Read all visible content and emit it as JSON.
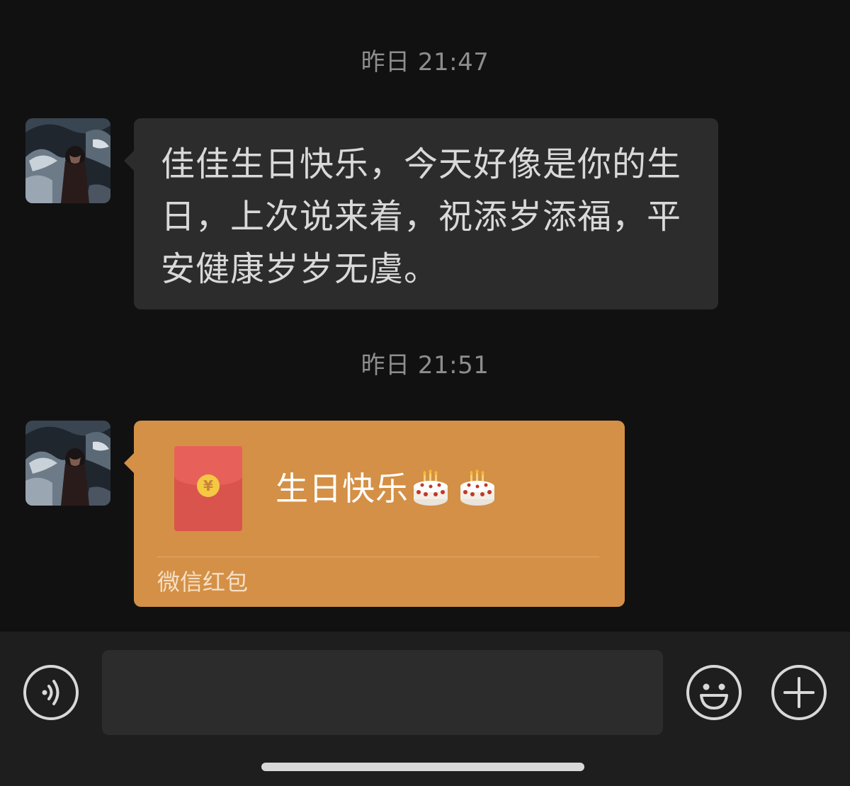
{
  "chat": {
    "messages": [
      {
        "timestamp": "昨日 21:47",
        "sender_avatar": "avatar-photo",
        "type": "text",
        "text": "佳佳生日快乐，今天好像是你的生日，上次说来着，祝添岁添福，平安健康岁岁无虞。"
      },
      {
        "timestamp": "昨日 21:51",
        "sender_avatar": "avatar-photo",
        "type": "red_packet",
        "title": "生日快乐",
        "emoji": [
          "cake-emoji",
          "cake-emoji"
        ],
        "footer": "微信红包",
        "icon": "red-envelope-icon",
        "coin_symbol": "¥"
      }
    ]
  },
  "input_bar": {
    "voice_icon": "voice-icon",
    "text_value": "",
    "emoji_icon": "emoji-icon",
    "plus_icon": "plus-icon"
  },
  "colors": {
    "background": "#111111",
    "bubble": "#2c2c2c",
    "red_packet": "#d49046",
    "envelope": "#d9544d",
    "input_bar": "#1e1e1e"
  }
}
